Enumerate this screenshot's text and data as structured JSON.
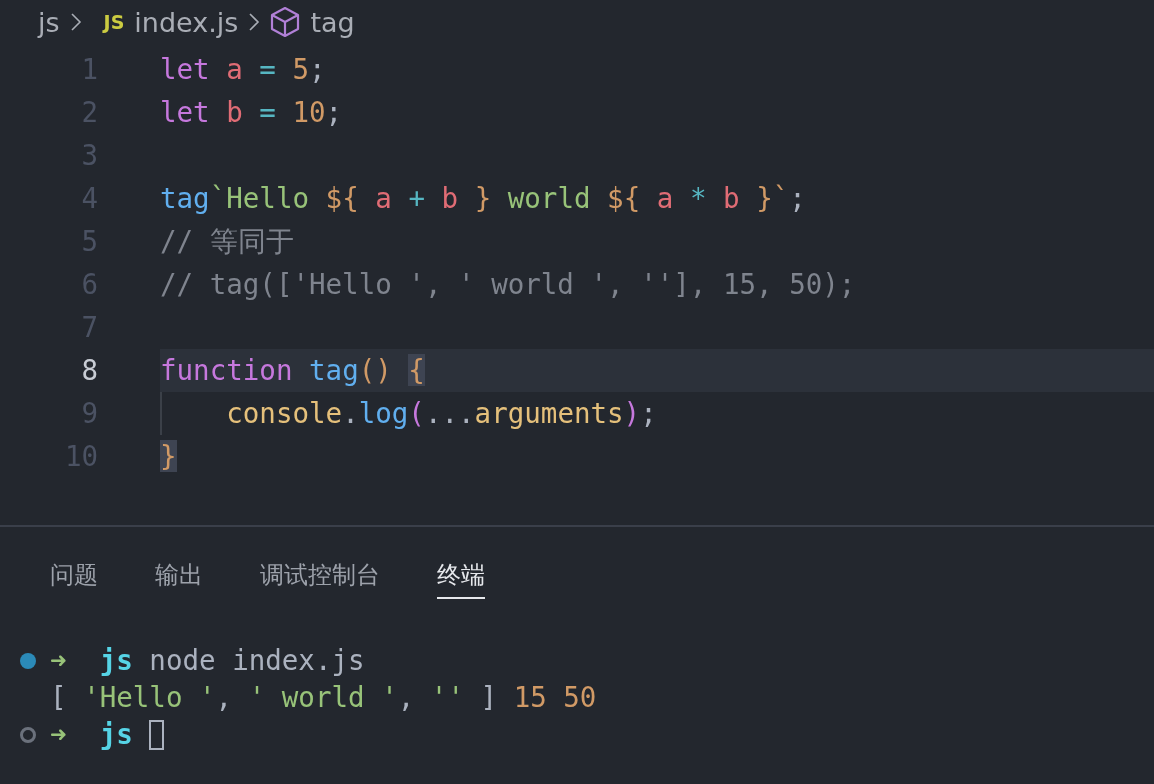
{
  "breadcrumb": [
    {
      "kind": "folder",
      "text": "js"
    },
    {
      "kind": "file",
      "badge": "JS",
      "text": "index.js"
    },
    {
      "kind": "symbol",
      "text": "tag"
    }
  ],
  "code": {
    "lines": [
      {
        "number": "1",
        "current": false,
        "tokens": [
          {
            "kind": "kw",
            "text": "let "
          },
          {
            "kind": "var",
            "text": "a "
          },
          {
            "kind": "op",
            "text": "= "
          },
          {
            "kind": "num",
            "text": "5"
          },
          {
            "kind": "p",
            "text": ";"
          }
        ]
      },
      {
        "number": "2",
        "current": false,
        "tokens": [
          {
            "kind": "kw",
            "text": "let "
          },
          {
            "kind": "var",
            "text": "b "
          },
          {
            "kind": "op",
            "text": "= "
          },
          {
            "kind": "num",
            "text": "10"
          },
          {
            "kind": "p",
            "text": ";"
          }
        ]
      },
      {
        "number": "3",
        "current": false
      },
      {
        "number": "4",
        "current": false,
        "tokens": [
          {
            "kind": "fn",
            "text": "tag"
          },
          {
            "kind": "str",
            "text": "`Hello "
          },
          {
            "kind": "tpl",
            "text": "${ "
          },
          {
            "kind": "var",
            "text": "a "
          },
          {
            "kind": "op",
            "text": "+ "
          },
          {
            "kind": "var",
            "text": "b "
          },
          {
            "kind": "tpl",
            "text": "}"
          },
          {
            "kind": "str",
            "text": " world "
          },
          {
            "kind": "tpl",
            "text": "${ "
          },
          {
            "kind": "var",
            "text": "a "
          },
          {
            "kind": "op",
            "text": "* "
          },
          {
            "kind": "var",
            "text": "b "
          },
          {
            "kind": "tpl",
            "text": "}`"
          },
          {
            "kind": "p",
            "text": ";"
          }
        ]
      },
      {
        "number": "5",
        "current": false,
        "tokens": [
          {
            "kind": "cm",
            "text": "// 等同于"
          }
        ]
      },
      {
        "number": "6",
        "current": false,
        "tokens": [
          {
            "kind": "cm",
            "text": "// tag(['Hello ', ' world ', ''], 15, 50);"
          }
        ]
      },
      {
        "number": "7",
        "current": false
      },
      {
        "number": "8",
        "current": true,
        "tokens": [
          {
            "kind": "kw",
            "text": "function "
          },
          {
            "kind": "fn",
            "text": "tag"
          },
          {
            "kind": "br1",
            "text": "() "
          },
          {
            "kind": "match",
            "text": "{"
          }
        ]
      },
      {
        "number": "9",
        "current": false,
        "tokens": [
          {
            "kind": "obj",
            "text": "    console"
          },
          {
            "kind": "p",
            "text": "."
          },
          {
            "kind": "fn",
            "text": "log"
          },
          {
            "kind": "br2",
            "text": "("
          },
          {
            "kind": "p",
            "text": "..."
          },
          {
            "kind": "obj",
            "text": "arguments"
          },
          {
            "kind": "br2",
            "text": ")"
          },
          {
            "kind": "p",
            "text": ";"
          }
        ]
      },
      {
        "number": "10",
        "current": false,
        "tokens": [
          {
            "kind": "match",
            "text": "}"
          }
        ]
      }
    ]
  },
  "panel": {
    "tabs": [
      {
        "label": "问题",
        "selected": false
      },
      {
        "label": "输出",
        "selected": false
      },
      {
        "label": "调试控制台",
        "selected": false
      },
      {
        "label": "终端",
        "selected": true
      }
    ],
    "terminal": [
      {
        "kind": "done",
        "cursor": false,
        "tokens": [
          {
            "kind": "arrow",
            "text": "➜  "
          },
          {
            "kind": "dir",
            "text": "js"
          },
          {
            "kind": "p",
            "text": " node index.js"
          }
        ]
      },
      {
        "kind": "output",
        "cursor": false,
        "tokens": [
          {
            "kind": "p",
            "text": "[ "
          },
          {
            "kind": "str",
            "text": "'Hello '"
          },
          {
            "kind": "p",
            "text": ", "
          },
          {
            "kind": "str",
            "text": "' world '"
          },
          {
            "kind": "p",
            "text": ", "
          },
          {
            "kind": "str",
            "text": "''"
          },
          {
            "kind": "p",
            "text": " ] "
          },
          {
            "kind": "num",
            "text": "15 50"
          }
        ]
      },
      {
        "kind": "empty",
        "cursor": true,
        "tokens": [
          {
            "kind": "arrow",
            "text": "➜  "
          },
          {
            "kind": "dir",
            "text": "js "
          }
        ]
      }
    ]
  }
}
